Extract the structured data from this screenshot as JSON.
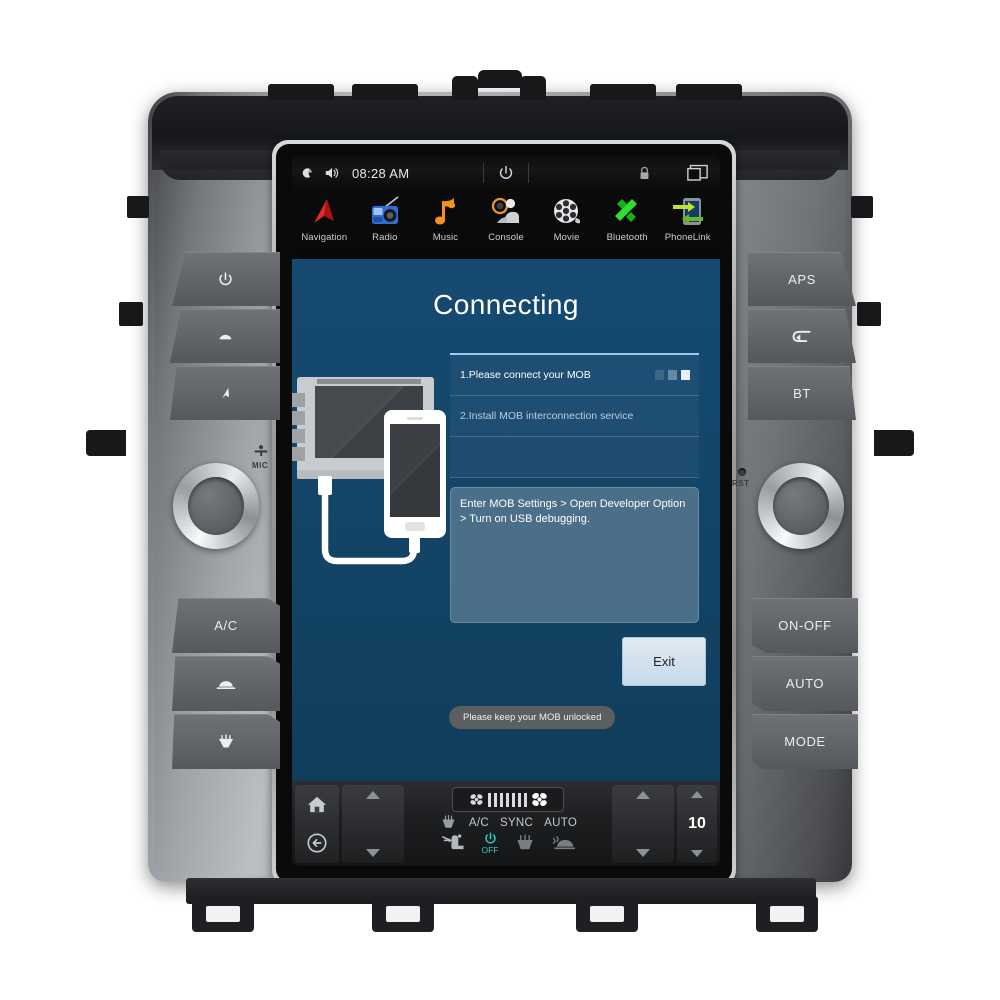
{
  "status_bar": {
    "night_icon": "moon-star-icon",
    "volume_icon": "speaker-icon",
    "time": "08:28 AM",
    "power_icon": "power-icon",
    "lock_icon": "lock-icon",
    "windows_icon": "recent-apps-icon"
  },
  "app_bar": {
    "apps": [
      {
        "label": "Navigation",
        "icon": "navigation-arrow-icon"
      },
      {
        "label": "Radio",
        "icon": "radio-icon"
      },
      {
        "label": "Music",
        "icon": "music-note-icon"
      },
      {
        "label": "Console",
        "icon": "console-driver-icon"
      },
      {
        "label": "Movie",
        "icon": "film-reel-icon"
      },
      {
        "label": "Bluetooth",
        "icon": "bluetooth-icon"
      },
      {
        "label": "PhoneLink",
        "icon": "phonelink-icon"
      }
    ]
  },
  "main": {
    "title": "Connecting",
    "steps": [
      {
        "text": "1.Please connect your MOB",
        "active": true
      },
      {
        "text": "2.Install MOB interconnection service",
        "active": false
      }
    ],
    "instruction": "Enter MOB Settings > Open Developer Option > Turn on USB debugging.",
    "exit_label": "Exit",
    "toast": "Please keep your MOB unlocked",
    "illustration": {
      "monitor": "head-unit-display",
      "phone": "mobile-phone",
      "cable": "usb-cable"
    }
  },
  "climate_bar": {
    "home_icon": "home-icon",
    "back_icon": "back-arrow-icon",
    "left_fan_icon": "fan-icon",
    "right_fan_icon": "fan-icon",
    "fan_level_bars": 7,
    "defrost_rear_icon": "rear-defrost-icon",
    "ac_label": "A/C",
    "sync_label": "SYNC",
    "auto_label": "AUTO",
    "airflow_icon": "airflow-seat-icon",
    "power_label": "OFF",
    "power_icon": "power-icon",
    "defrost_front_icon": "front-defrost-icon",
    "windshield_icon": "windshield-defrost-icon",
    "temperature": "10",
    "up_arrow": "triangle-up-icon",
    "down_arrow": "triangle-down-icon"
  },
  "hardware": {
    "left_buttons": [
      {
        "label": "",
        "icon": "power-icon"
      },
      {
        "label": "",
        "icon": "home-icon"
      },
      {
        "label": "",
        "icon": "navigation-icon"
      }
    ],
    "left_buttons_lower": [
      {
        "label": "A/C",
        "icon": ""
      },
      {
        "label": "",
        "icon": "front-defrost-icon"
      },
      {
        "label": "",
        "icon": "rear-defrost-icon"
      }
    ],
    "right_buttons": [
      {
        "label": "APS",
        "icon": ""
      },
      {
        "label": "",
        "icon": "back-arrow-icon"
      },
      {
        "label": "BT",
        "icon": ""
      }
    ],
    "right_buttons_lower": [
      {
        "label": "ON-OFF",
        "icon": ""
      },
      {
        "label": "AUTO",
        "icon": ""
      },
      {
        "label": "MODE",
        "icon": ""
      }
    ],
    "mic_label": "MIC",
    "rst_label": "RST",
    "left_knob": "volume-knob",
    "right_knob": "tune-knob"
  },
  "colors": {
    "screen_blue": "#15466b",
    "accent_line": "#9ecbe8",
    "instruction_bg": "#4b6f88",
    "exit_bg": "#d4e2ee",
    "climate_teal": "#2ecfc8",
    "bezel_silver": "#b7babd"
  }
}
